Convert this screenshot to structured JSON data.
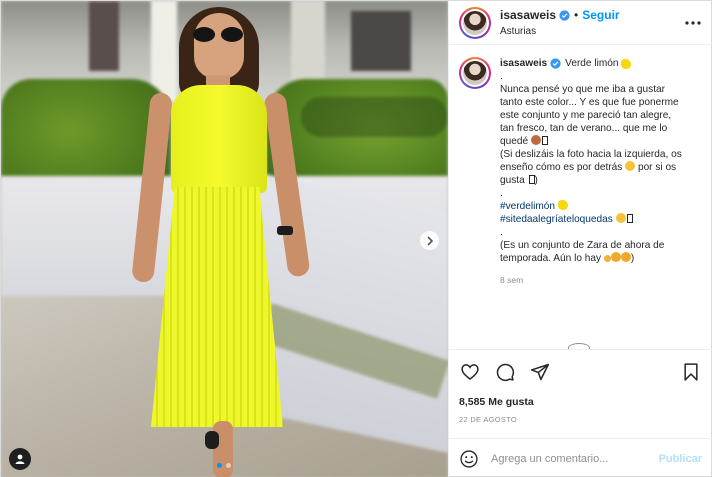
{
  "post": {
    "username": "isasaweis",
    "follow_label": "Seguir",
    "separator": "•",
    "location": "Asturias",
    "colors": {
      "accent": "#0095f6",
      "dress": "#eef72a",
      "hashtag": "#00376b"
    }
  },
  "caption": {
    "username": "isasaweis",
    "lines": [
      "Verde limón",
      ".",
      "Nunca pensé yo que me iba a gustar",
      "tanto este color... Y es que fue ponerme",
      "este conjunto y me pareció tan alegre,",
      "tan fresco, tan de verano... que me lo",
      "quedé",
      "(Si deslizáis la foto hacia la izquierda, os",
      "enseño cómo es por detrás",
      "por si os",
      "gusta",
      ")",
      ".",
      "#verdelimón",
      "#sitedaalegríateloquedas",
      ".",
      "(Es un conjunto de Zara de ahora de",
      "temporada. Aún lo hay",
      ")"
    ],
    "time": "8 sem",
    "icons": [
      "lemon-emoji",
      "woman-emoji",
      "smile-emoji",
      "grin-emoji"
    ]
  },
  "actions": {
    "icons": [
      "heart-icon",
      "comment-icon",
      "share-icon",
      "bookmark-icon"
    ]
  },
  "likes": "8,585 Me gusta",
  "date": "22 DE AGOSTO",
  "comment_box": {
    "placeholder": "Agrega un comentario...",
    "publish_label": "Publicar"
  },
  "carousel": {
    "current": 1,
    "total": 2
  }
}
